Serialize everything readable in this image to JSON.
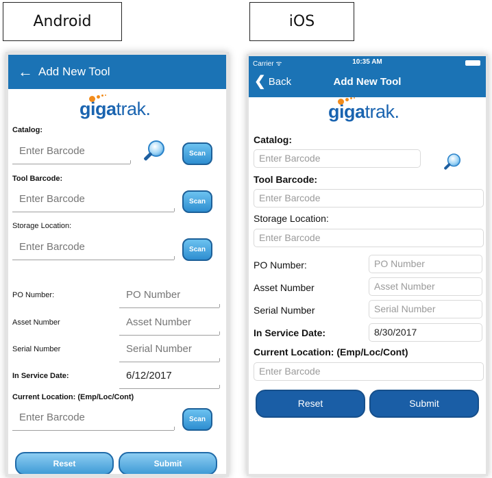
{
  "platform_labels": {
    "android": "Android",
    "ios": "iOS"
  },
  "logo": {
    "brand_bold": "giga",
    "brand_regular": "trak."
  },
  "android": {
    "appbar": {
      "back_icon": "←",
      "title": "Add New Tool"
    },
    "catalog": {
      "label": "Catalog:",
      "placeholder": "Enter Barcode",
      "scan": "Scan"
    },
    "tool_barcode": {
      "label": "Tool Barcode:",
      "placeholder": "Enter Barcode",
      "scan": "Scan"
    },
    "storage_location": {
      "label": "Storage Location:",
      "placeholder": "Enter Barcode",
      "scan": "Scan"
    },
    "po_number": {
      "label": "PO Number:",
      "placeholder": "PO Number"
    },
    "asset_number": {
      "label": "Asset Number",
      "placeholder": "Asset Number"
    },
    "serial_number": {
      "label": "Serial Number",
      "placeholder": "Serial Number"
    },
    "in_service_date": {
      "label": "In Service Date:",
      "value": "6/12/2017"
    },
    "current_location": {
      "label": "Current Location: (Emp/Loc/Cont)",
      "placeholder": "Enter Barcode",
      "scan": "Scan"
    },
    "buttons": {
      "reset": "Reset",
      "submit": "Submit"
    }
  },
  "ios": {
    "status": {
      "carrier": "Carrier ᯤ",
      "time": "10:35 AM"
    },
    "navbar": {
      "back_chevron": "❮",
      "back": "Back",
      "title": "Add New Tool"
    },
    "catalog": {
      "label": "Catalog:",
      "placeholder": "Enter Barcode"
    },
    "tool_barcode": {
      "label": "Tool Barcode:",
      "placeholder": "Enter Barcode"
    },
    "storage_location": {
      "label": "Storage Location:",
      "placeholder": "Enter Barcode"
    },
    "po_number": {
      "label": "PO Number:",
      "placeholder": "PO Number"
    },
    "asset_number": {
      "label": "Asset Number",
      "placeholder": "Asset Number"
    },
    "serial_number": {
      "label": "Serial Number",
      "placeholder": "Serial Number"
    },
    "in_service_date": {
      "label": "In Service Date:",
      "value": "8/30/2017"
    },
    "current_location": {
      "label": "Current Location: (Emp/Loc/Cont)",
      "placeholder": "Enter Barcode"
    },
    "buttons": {
      "reset": "Reset",
      "submit": "Submit"
    }
  },
  "colors": {
    "primary": "#1b73b5",
    "ios_button": "#1a5ea6",
    "android_button": "#3f9bd6",
    "logo_blue": "#1a64b0",
    "logo_orange": "#f28c1c"
  }
}
